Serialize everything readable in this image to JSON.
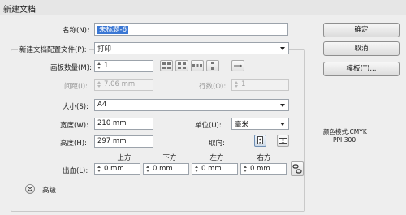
{
  "window": {
    "title": "新建文档"
  },
  "name": {
    "label": "名称(N):",
    "value": "未标题-6"
  },
  "profile": {
    "label": "新建文档配置文件(P):",
    "value": "打印"
  },
  "artboards": {
    "count_label": "画板数量(M):",
    "count_value": "1",
    "spacing_label": "间距(I):",
    "spacing_value": "7.06 mm",
    "columns_label": "行数(O):",
    "columns_value": "1"
  },
  "size": {
    "label": "大小(S):",
    "value": "A4"
  },
  "width": {
    "label": "宽度(W):",
    "value": "210 mm"
  },
  "units": {
    "label": "单位(U):",
    "value": "毫米"
  },
  "height": {
    "label": "高度(H):",
    "value": "297 mm"
  },
  "orientation": {
    "label": "取向:"
  },
  "bleed": {
    "label": "出血(L):",
    "top_label": "上方",
    "bottom_label": "下方",
    "left_label": "左方",
    "right_label": "右方",
    "top": "0 mm",
    "bottom": "0 mm",
    "left": "0 mm",
    "right": "0 mm"
  },
  "advanced": {
    "label": "高级"
  },
  "buttons": {
    "ok": "确定",
    "cancel": "取消",
    "templates": "模板(T)..."
  },
  "info": {
    "color_mode": "颜色模式:CMYK",
    "ppi": "PPI:300"
  }
}
